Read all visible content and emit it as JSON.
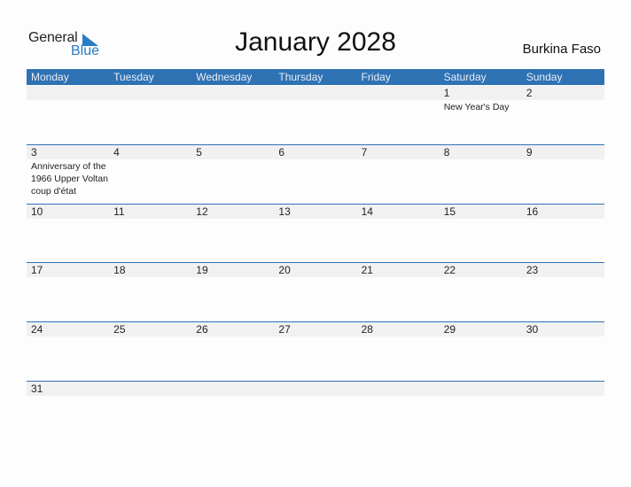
{
  "logo": {
    "line1": "General",
    "line2": "Blue"
  },
  "title": "January 2028",
  "country": "Burkina Faso",
  "weekdays": [
    "Monday",
    "Tuesday",
    "Wednesday",
    "Thursday",
    "Friday",
    "Saturday",
    "Sunday"
  ],
  "weeks": [
    [
      {
        "day": ""
      },
      {
        "day": ""
      },
      {
        "day": ""
      },
      {
        "day": ""
      },
      {
        "day": ""
      },
      {
        "day": "1",
        "event": "New Year's Day"
      },
      {
        "day": "2"
      }
    ],
    [
      {
        "day": "3",
        "event": "Anniversary of the 1966 Upper Voltan coup d'état"
      },
      {
        "day": "4"
      },
      {
        "day": "5"
      },
      {
        "day": "6"
      },
      {
        "day": "7"
      },
      {
        "day": "8"
      },
      {
        "day": "9"
      }
    ],
    [
      {
        "day": "10"
      },
      {
        "day": "11"
      },
      {
        "day": "12"
      },
      {
        "day": "13"
      },
      {
        "day": "14"
      },
      {
        "day": "15"
      },
      {
        "day": "16"
      }
    ],
    [
      {
        "day": "17"
      },
      {
        "day": "18"
      },
      {
        "day": "19"
      },
      {
        "day": "20"
      },
      {
        "day": "21"
      },
      {
        "day": "22"
      },
      {
        "day": "23"
      }
    ],
    [
      {
        "day": "24"
      },
      {
        "day": "25"
      },
      {
        "day": "26"
      },
      {
        "day": "27"
      },
      {
        "day": "28"
      },
      {
        "day": "29"
      },
      {
        "day": "30"
      }
    ],
    [
      {
        "day": "31"
      },
      {
        "day": ""
      },
      {
        "day": ""
      },
      {
        "day": ""
      },
      {
        "day": ""
      },
      {
        "day": ""
      },
      {
        "day": ""
      }
    ]
  ],
  "colors": {
    "accent": "#2e72b4",
    "band": "#f1f1f1"
  }
}
